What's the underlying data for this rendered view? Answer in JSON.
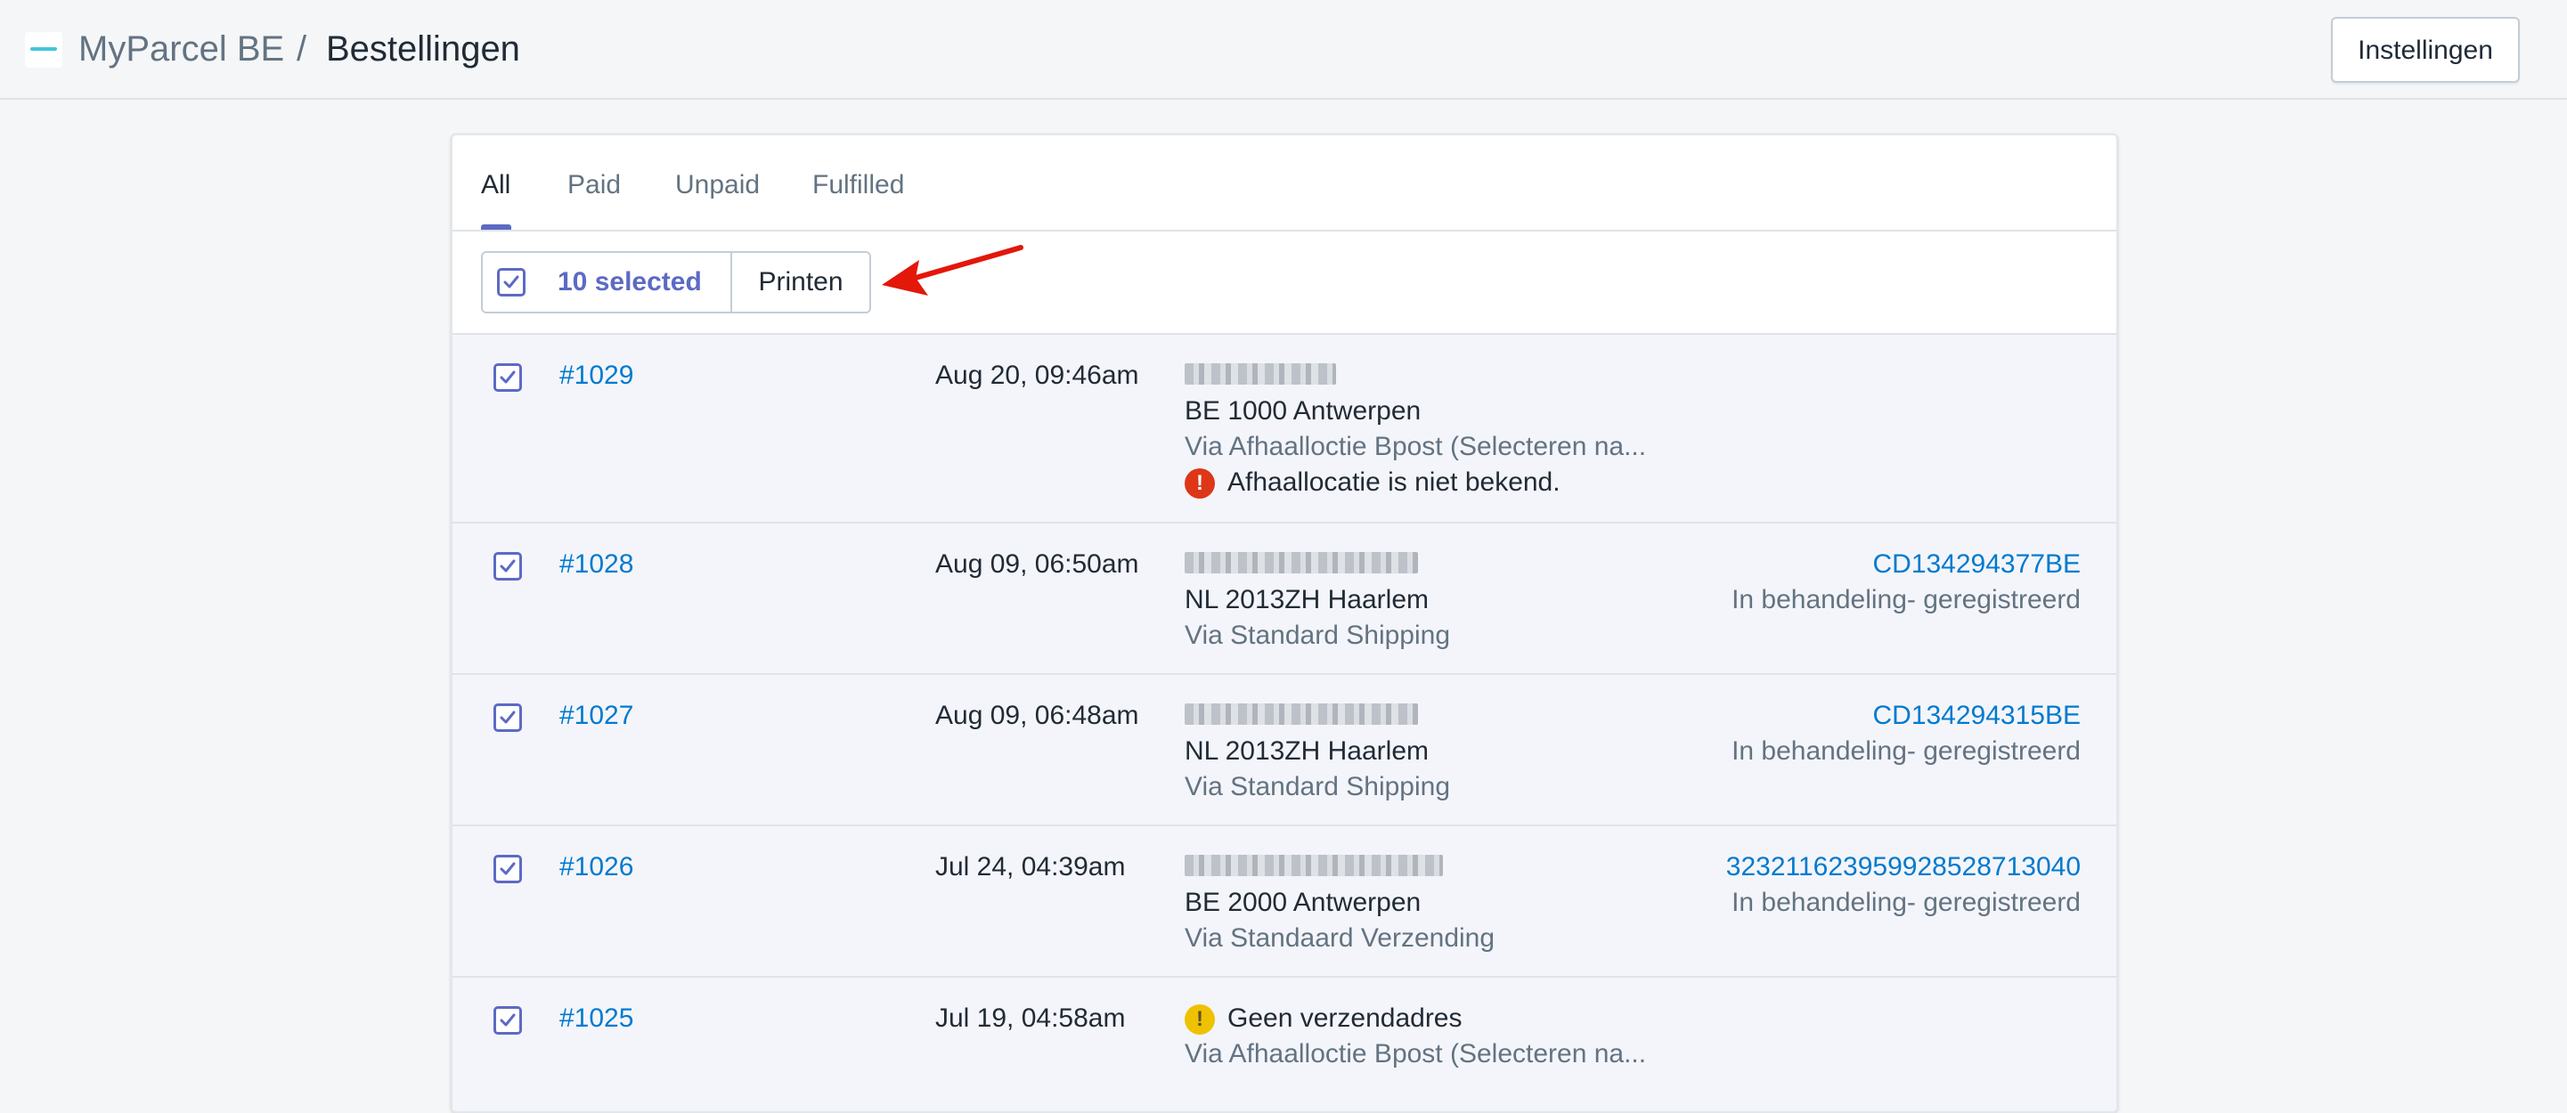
{
  "header": {
    "app_name": "MyParcel BE",
    "separator": "/",
    "page_title": "Bestellingen",
    "settings_label": "Instellingen"
  },
  "tabs": [
    {
      "label": "All",
      "active": true
    },
    {
      "label": "Paid",
      "active": false
    },
    {
      "label": "Unpaid",
      "active": false
    },
    {
      "label": "Fulfilled",
      "active": false
    }
  ],
  "bulk": {
    "selected_label": "10 selected",
    "print_label": "Printen",
    "checked": true
  },
  "orders": [
    {
      "number": "#1029",
      "date": "Aug 20, 09:46am",
      "address": "BE 1000 Antwerpen",
      "shipping": "Via Afhaalloctie Bpost (Selecteren na...",
      "warning": "Afhaallocatie is niet bekend.",
      "warning_type": "error",
      "tracking": "",
      "status": "",
      "checked": true
    },
    {
      "number": "#1028",
      "date": "Aug 09, 06:50am",
      "address": "NL 2013ZH Haarlem",
      "shipping": "Via Standard Shipping",
      "tracking": "CD134294377BE",
      "status": "In behandeling- geregistreerd",
      "checked": true
    },
    {
      "number": "#1027",
      "date": "Aug 09, 06:48am",
      "address": "NL 2013ZH Haarlem",
      "shipping": "Via Standard Shipping",
      "tracking": "CD134294315BE",
      "status": "In behandeling- geregistreerd",
      "checked": true
    },
    {
      "number": "#1026",
      "date": "Jul 24, 04:39am",
      "address": "BE 2000 Antwerpen",
      "shipping": "Via Standaard Verzending",
      "tracking": "323211623959928528713040",
      "status": "In behandeling- geregistreerd",
      "checked": true
    },
    {
      "number": "#1025",
      "date": "Jul 19, 04:58am",
      "address": "Geen verzendadres",
      "warning_type": "warning",
      "shipping": "Via Afhaalloctie Bpost (Selecteren na...",
      "tracking": "",
      "status": "",
      "checked": true
    }
  ],
  "colors": {
    "accent": "#5c6ac4",
    "link": "#007ace",
    "error": "#de3618",
    "warning": "#eec200",
    "arrow": "#e3170a"
  },
  "icons": {
    "logo": "myparcel-logo-icon",
    "checkbox": "checkmark-icon",
    "error": "error-circle-icon",
    "warning": "warning-circle-icon",
    "annotation": "red-arrow-icon"
  }
}
